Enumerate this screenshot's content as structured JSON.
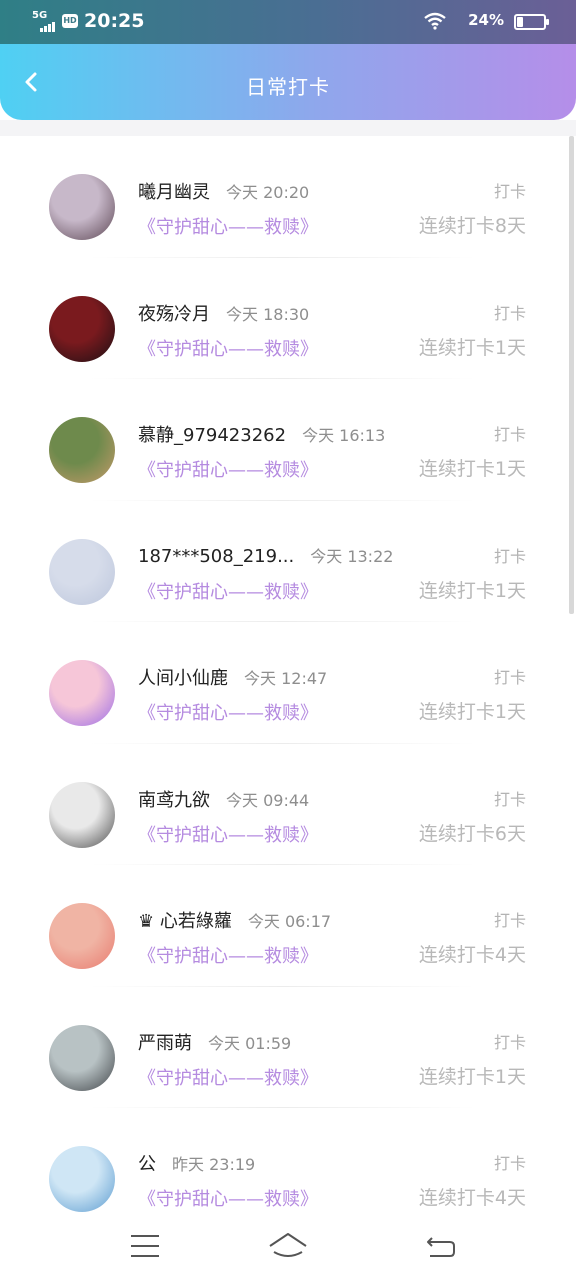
{
  "status_bar": {
    "network": "5G",
    "hd": "HD",
    "time": "20:25",
    "battery": "24%",
    "battery_level": 0.24
  },
  "header": {
    "title": "日常打卡",
    "back_icon": "chevron-left-icon"
  },
  "entries": [
    {
      "name": "曦月幽灵",
      "time": "今天 20:20",
      "action": "打卡",
      "book": "《守护甜心——救赎》",
      "streak": "连续打卡8天",
      "avatar_colors": [
        "#c7b8c9",
        "#5b4552"
      ]
    },
    {
      "name": "夜殇冷月",
      "time": "今天 18:30",
      "action": "打卡",
      "book": "《守护甜心——救赎》",
      "streak": "连续打卡1天",
      "avatar_colors": [
        "#7a1a1e",
        "#1a0f14"
      ]
    },
    {
      "name": "慕静_979423262",
      "time": "今天 16:13",
      "action": "打卡",
      "book": "《守护甜心——救赎》",
      "streak": "连续打卡1天",
      "avatar_colors": [
        "#6e8a4c",
        "#c79a6a"
      ]
    },
    {
      "name": "187***508_219...",
      "time": "今天 13:22",
      "action": "打卡",
      "book": "《守护甜心——救赎》",
      "streak": "连续打卡1天",
      "avatar_colors": [
        "#d6dcea",
        "#bcc6dc"
      ]
    },
    {
      "name": "人间小仙鹿",
      "time": "今天 12:47",
      "action": "打卡",
      "book": "《守护甜心——救赎》",
      "streak": "连续打卡1天",
      "avatar_colors": [
        "#f6c6d8",
        "#9b6be6"
      ]
    },
    {
      "name": "南鸢九欲",
      "time": "今天 09:44",
      "action": "打卡",
      "book": "《守护甜心——救赎》",
      "streak": "连续打卡6天",
      "avatar_colors": [
        "#e9e9e9",
        "#4a4a4a"
      ]
    },
    {
      "name": "♛ 心若綠蘿",
      "time": "今天 06:17",
      "action": "打卡",
      "book": "《守护甜心——救赎》",
      "streak": "连续打卡4天",
      "avatar_colors": [
        "#f0b4a4",
        "#e87a6e"
      ]
    },
    {
      "name": "严雨萌",
      "time": "今天 01:59",
      "action": "打卡",
      "book": "《守护甜心——救赎》",
      "streak": "连续打卡1天",
      "avatar_colors": [
        "#b8c2c4",
        "#3e4246"
      ]
    },
    {
      "name": "公",
      "time": "昨天 23:19",
      "action": "打卡",
      "book": "《守护甜心——救赎》",
      "streak": "连续打卡4天",
      "avatar_colors": [
        "#cfe6f5",
        "#5b9bd0"
      ]
    }
  ],
  "nav": {
    "menu_icon": "menu-icon",
    "home_icon": "home-icon",
    "back_icon": "back-arrow-icon"
  }
}
